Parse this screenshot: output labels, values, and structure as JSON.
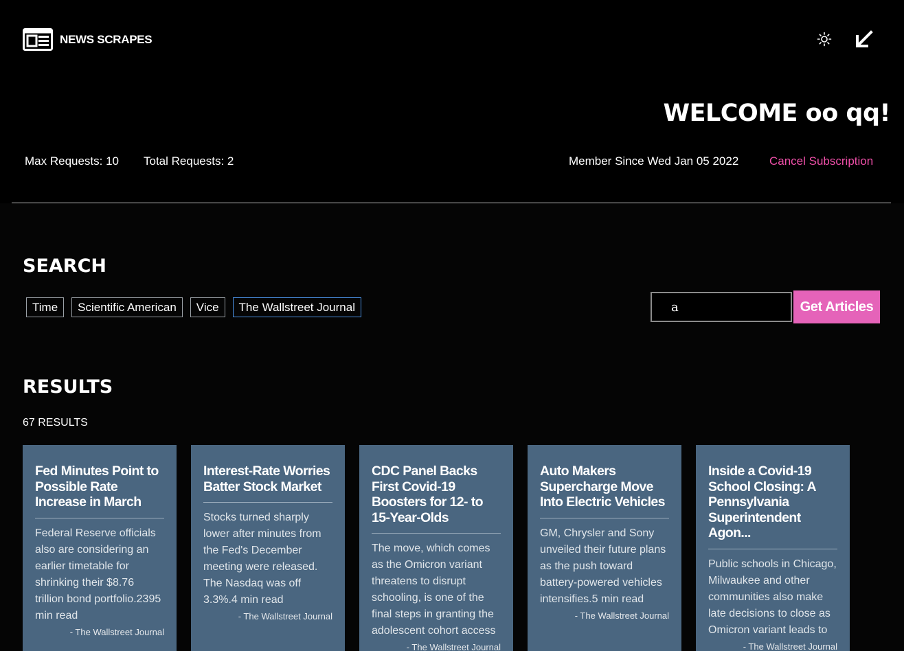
{
  "header": {
    "app_name": "NEWS SCRAPES",
    "welcome": "WELCOME oo qq!",
    "max_requests": "Max Requests: 10",
    "total_requests": "Total Requests: 2",
    "member_since": "Member Since Wed Jan 05 2022",
    "cancel_subscription": "Cancel Subscription"
  },
  "search": {
    "title": "SEARCH",
    "sources": [
      {
        "label": "Time",
        "selected": false
      },
      {
        "label": "Scientific American",
        "selected": false
      },
      {
        "label": "Vice",
        "selected": false
      },
      {
        "label": "The Wallstreet Journal",
        "selected": true
      }
    ],
    "query": "a",
    "button_label": "Get Articles"
  },
  "results": {
    "title": "RESULTS",
    "count": "67 RESULTS",
    "articles": [
      {
        "title": "Fed Minutes Point to Possible Rate Increase in March",
        "description": "Federal Reserve officials also are considering an earlier timetable for shrinking their $8.76 trillion bond portfolio.2395 min read",
        "source": "- The Wallstreet Journal"
      },
      {
        "title": "Interest-Rate Worries Batter Stock Market",
        "description": "Stocks turned sharply lower after minutes from the Fed's December meeting were released. The Nasdaq was off 3.3%.4 min read",
        "source": "- The Wallstreet Journal"
      },
      {
        "title": "CDC Panel Backs First Covid-19 Boosters for 12- to 15-Year-Olds",
        "description": "The move, which comes as the Omicron variant threatens to disrupt schooling, is one of the final steps in granting the adolescent cohort access",
        "source": "- The Wallstreet Journal"
      },
      {
        "title": "Auto Makers Supercharge Move Into Electric Vehicles",
        "description": "GM, Chrysler and Sony unveiled their future plans as the push toward battery-powered vehicles intensifies.5 min read",
        "source": "- The Wallstreet Journal"
      },
      {
        "title": "Inside a Covid-19 School Closing: A Pennsylvania Superintendent Agon...",
        "description": "Public schools in Chicago, Milwaukee and other communities also make late decisions to close as Omicron variant leads to",
        "source": "- The Wallstreet Journal"
      }
    ]
  },
  "icons": {
    "logo": "newspaper-icon",
    "theme": "sun-icon",
    "logout": "arrow-down-left-icon"
  },
  "colors": {
    "accent_pink": "#e563b9",
    "cancel_link": "#ee4fa8",
    "card_bg": "#4a6680",
    "selected_chip_border": "#4a90e2"
  }
}
